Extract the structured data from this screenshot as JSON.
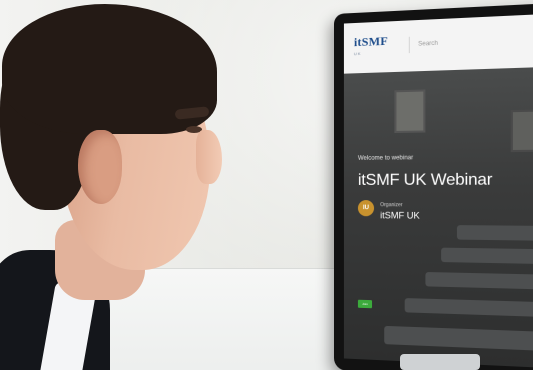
{
  "screen": {
    "logo": "itSMF",
    "logo_sub": "UK",
    "search_placeholder": "Search",
    "room_sign": "",
    "welcome_text": "Welcome to webinar",
    "webinar_title": "itSMF UK Webinar",
    "avatar_initials": "IU",
    "organizer_label": "Organizer",
    "organizer_name": "itSMF UK",
    "join_label": "Join",
    "colors": {
      "logo": "#1f4e8c",
      "join_button": "#3cab3c",
      "avatar": "#c8922e"
    }
  }
}
